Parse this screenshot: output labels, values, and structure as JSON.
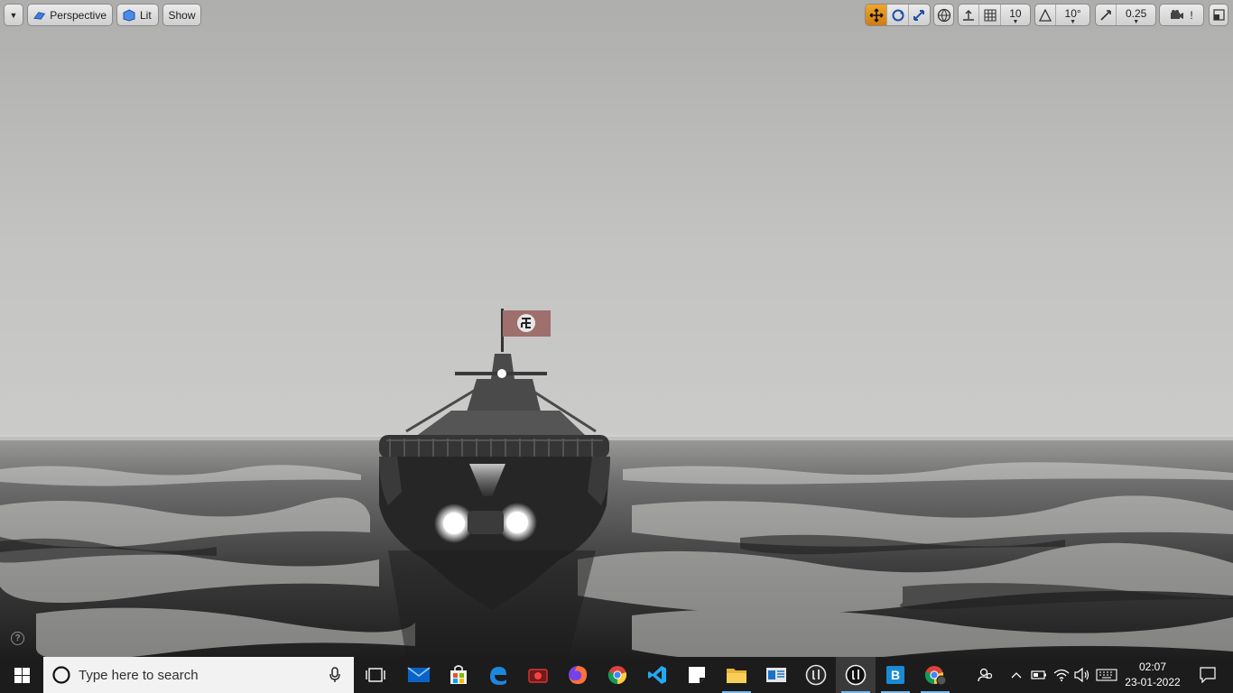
{
  "viewport_toolbar": {
    "menu_icon": "chevron-down-icon",
    "perspective_label": "Perspective",
    "lit_label": "Lit",
    "show_label": "Show",
    "grid_snap_value": "10",
    "rotation_snap_value": "10°",
    "scale_snap_value": "0.25",
    "camera_speed_value": "!",
    "active_color": "#e4931f"
  },
  "taskbar": {
    "search_placeholder": "Type here to search",
    "time": "02:07",
    "date": "23-01-2022",
    "apps": [
      "task-view-icon",
      "mail-icon",
      "store-icon",
      "edge-icon",
      "recorder-icon",
      "firefox-icon",
      "chrome-icon",
      "vscode-icon",
      "sticky-notes-icon",
      "file-explorer-icon",
      "news-icon",
      "unreal-engine-icon",
      "unreal-editor-icon",
      "blender-b-icon",
      "chrome-profile-icon"
    ],
    "accent_color": "#76b9ed"
  }
}
